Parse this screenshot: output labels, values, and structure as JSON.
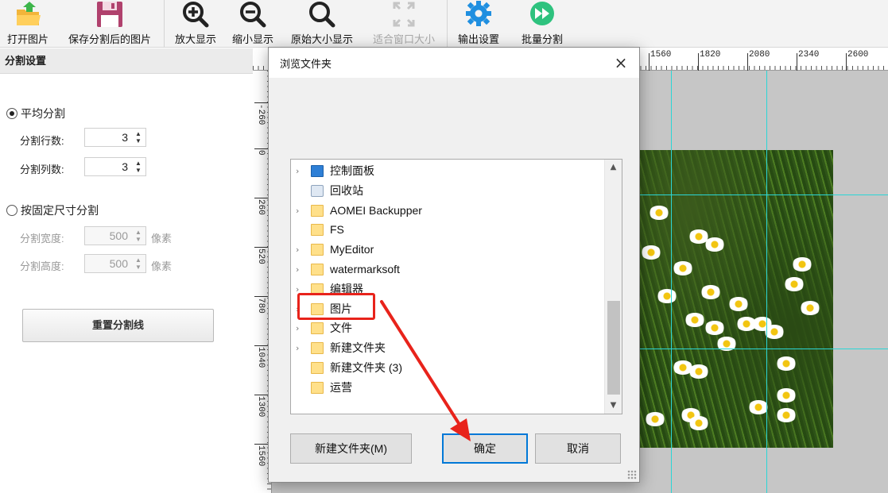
{
  "toolbar": {
    "open_label": "打开图片",
    "save_label": "保存分割后的图片",
    "zoom_in_label": "放大显示",
    "zoom_out_label": "缩小显示",
    "original_size_label": "原始大小显示",
    "fit_window_label": "适合窗口大小",
    "output_settings_label": "输出设置",
    "batch_split_label": "批量分割"
  },
  "left_panel": {
    "header": "分割设置",
    "even_split_label": "平均分割",
    "rows_label": "分割行数:",
    "rows_value": "3",
    "cols_label": "分割列数:",
    "cols_value": "3",
    "fixed_size_label": "按固定尺寸分割",
    "width_label": "分割宽度:",
    "width_value": "500",
    "height_label": "分割高度:",
    "height_value": "500",
    "unit": "像素",
    "reset_label": "重置分割线",
    "even_split_selected": true
  },
  "ruler": {
    "top_labels": [
      "1560",
      "1820",
      "2080",
      "2340",
      "2600"
    ],
    "left_labels": [
      "-260",
      "0",
      "260",
      "520",
      "780",
      "1040",
      "1300",
      "1560"
    ]
  },
  "dialog": {
    "title": "浏览文件夹",
    "close_icon": "×",
    "items": [
      {
        "label": "控制面板",
        "icon": "control-panel-icon",
        "expandable": true
      },
      {
        "label": "回收站",
        "icon": "recycle-bin-icon",
        "expandable": false
      },
      {
        "label": "AOMEI Backupper",
        "icon": "folder-icon",
        "expandable": true
      },
      {
        "label": "FS",
        "icon": "folder-icon",
        "expandable": false
      },
      {
        "label": "MyEditor",
        "icon": "folder-icon",
        "expandable": true
      },
      {
        "label": "watermarksoft",
        "icon": "folder-icon",
        "expandable": true
      },
      {
        "label": "编辑器",
        "icon": "folder-icon",
        "expandable": true
      },
      {
        "label": "图片",
        "icon": "folder-icon",
        "expandable": true,
        "selected": true
      },
      {
        "label": "文件",
        "icon": "folder-icon",
        "expandable": true
      },
      {
        "label": "新建文件夹",
        "icon": "folder-icon",
        "expandable": true
      },
      {
        "label": "新建文件夹 (3)",
        "icon": "folder-icon",
        "expandable": false
      },
      {
        "label": "运营",
        "icon": "folder-icon",
        "expandable": false
      }
    ],
    "new_folder_label": "新建文件夹(M)",
    "ok_label": "确定",
    "cancel_label": "取消"
  },
  "colors": {
    "guide": "#2bd6d6",
    "annotation": "#e8231b",
    "primary_border": "#0078d7"
  }
}
